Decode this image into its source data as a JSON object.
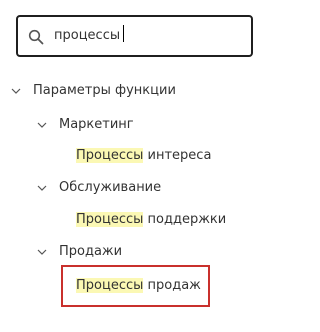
{
  "search": {
    "value": "процессы"
  },
  "tree": {
    "root": {
      "label": "Параметры функции"
    },
    "groups": [
      {
        "label": "Маркетинг",
        "item": {
          "match": "Процессы",
          "rest": " интереса"
        }
      },
      {
        "label": "Обслуживание",
        "item": {
          "match": "Процессы",
          "rest": " поддержки"
        }
      },
      {
        "label": "Продажи",
        "item": {
          "match": "Процессы",
          "rest": " продаж"
        }
      }
    ]
  },
  "colors": {
    "highlight": "#fbf8b4",
    "selection_border": "#c9302c"
  }
}
